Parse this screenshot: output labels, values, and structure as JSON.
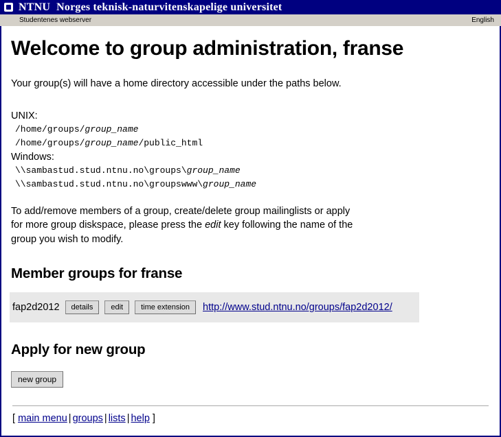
{
  "titlebar": {
    "logo_icon": "ntnu-square-logo-icon",
    "brand": "NTNU",
    "tagline": "Norges teknisk-naturvitenskapelige universitet",
    "background_color": "#000080",
    "text_color": "#ffffff"
  },
  "subbar": {
    "left_label": "Studentenes webserver",
    "right_label": "English",
    "background_color": "#d4d0c8"
  },
  "main": {
    "page_title": "Welcome to group administration, franse",
    "intro": "Your group(s) will have a home directory accessible under the paths below.",
    "paths": {
      "unix_label": "UNIX:",
      "unix_lines": [
        {
          "prefix": "/home/groups/",
          "placeholder": "group_name",
          "suffix": ""
        },
        {
          "prefix": "/home/groups/",
          "placeholder": "group_name",
          "suffix": "/public_html"
        }
      ],
      "windows_label": "Windows:",
      "windows_lines": [
        {
          "prefix": "\\\\sambastud.stud.ntnu.no\\groups\\",
          "placeholder": "group_name",
          "suffix": ""
        },
        {
          "prefix": "\\\\sambastud.stud.ntnu.no\\groupswww\\",
          "placeholder": "group_name",
          "suffix": ""
        }
      ]
    },
    "instructions": {
      "part1": "To add/remove members of a group, create/delete group mailinglists or apply for more group diskspace, please press the ",
      "emphasis": "edit",
      "part2": " key following the name of the group you wish to modify."
    },
    "member_groups": {
      "heading": "Member groups for franse",
      "rows": [
        {
          "name": "fap2d2012",
          "buttons": [
            {
              "label": "details"
            },
            {
              "label": "edit"
            },
            {
              "label": "time extension"
            }
          ],
          "link_text": "http://www.stud.ntnu.no/groups/fap2d2012/"
        }
      ]
    },
    "apply_new_group": {
      "heading": "Apply for new group",
      "button_label": "new group"
    }
  },
  "footer": {
    "open_bracket": "[",
    "close_bracket": "]",
    "links": [
      {
        "label": "main menu"
      },
      {
        "label": "groups"
      },
      {
        "label": "lists"
      },
      {
        "label": "help"
      }
    ],
    "separator": "|",
    "link_color": "#00008b"
  }
}
